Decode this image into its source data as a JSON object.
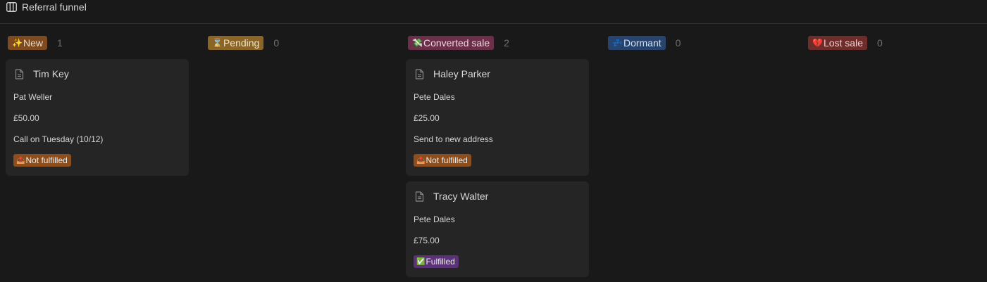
{
  "view": {
    "title": "Referral funnel",
    "icon": "board-view-icon"
  },
  "colors": {
    "new": "#7d4b1f",
    "pending": "#8a6526",
    "converted": "#6c2f4a",
    "dormant": "#26446e",
    "lost": "#6e2c2a",
    "not_fulfilled": "#8c4e1c",
    "fulfilled": "#5b3277"
  },
  "columns": [
    {
      "key": "new",
      "emoji": "✨",
      "label": "New",
      "count": "1"
    },
    {
      "key": "pending",
      "emoji": "⌛",
      "label": "Pending",
      "count": "0"
    },
    {
      "key": "converted",
      "emoji": "💸",
      "label": "Converted sale",
      "count": "2"
    },
    {
      "key": "dormant",
      "emoji": "💤",
      "label": "Dormant",
      "count": "0"
    },
    {
      "key": "lost",
      "emoji": "💔",
      "label": "Lost sale",
      "count": "0"
    }
  ],
  "cards": {
    "tim_key": {
      "title": "Tim Key",
      "referrer": "Pat Weller",
      "amount": "£50.00",
      "note": "Call on Tuesday (10/12)",
      "status": {
        "emoji": "📤",
        "label": "Not fulfilled"
      }
    },
    "haley_parker": {
      "title": "Haley Parker",
      "referrer": "Pete Dales",
      "amount": "£25.00",
      "note": "Send to new address",
      "status": {
        "emoji": "📤",
        "label": "Not fulfilled"
      }
    },
    "tracy_walter": {
      "title": "Tracy Walter",
      "referrer": "Pete Dales",
      "amount": "£75.00",
      "status": {
        "emoji": "✅",
        "label": "Fulfilled"
      }
    }
  }
}
